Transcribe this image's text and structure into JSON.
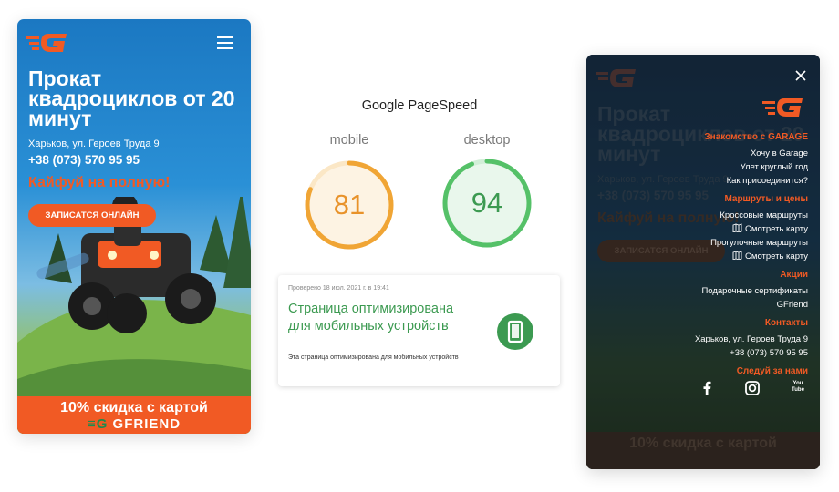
{
  "left_phone": {
    "headline": "Прокат квадроциклов от 20 минут",
    "address": "Харьков, ул. Героев Труда 9",
    "phone": "+38 (073) 570 95 95",
    "slogan": "Кайфуй на полную!",
    "cta_label": "ЗАПИСАТСЯ ОНЛАЙН",
    "discount": "10% скидка с картой",
    "partner_logo": "GFRIEND",
    "icons": [
      "garage-logo",
      "hamburger-menu-icon"
    ],
    "colors": {
      "accent": "#f15a24",
      "sky": "#1b78c2"
    }
  },
  "pagespeed": {
    "title": "Google PageSpeed",
    "gauges": [
      {
        "label": "mobile",
        "score": "81",
        "color": "#f0a535"
      },
      {
        "label": "desktop",
        "score": "94",
        "color": "#55c168"
      }
    ],
    "card": {
      "checked": "Проверено 18 июл. 2021 г. в 19:41",
      "heading": "Страница оптимизирована для мобильных устройств",
      "description": "Эта страница оптимизирована для мобильных устройств",
      "icon": "mobile-phone-icon"
    }
  },
  "menu_phone": {
    "bg": {
      "headline": "Прокат квадроциклов от 20 минут",
      "address": "Харьков, ул. Героев Труда 9",
      "phone": "+38 (073) 570 95 95",
      "slogan": "Кайфуй на полную!",
      "cta": "ЗАПИСАТСЯ ОНЛАЙН",
      "discount": "10% скидка с картой"
    },
    "sections": [
      {
        "title": "Знакомство с GARAGE",
        "items": [
          "Хочу в Garage",
          "Улет круглый год",
          "Как присоединится?"
        ]
      },
      {
        "title": "Маршруты и цены",
        "items": [
          "Кроссовые маршруты",
          "Смотреть карту",
          "Прогулочные маршруты",
          "Смотреть карту"
        ]
      },
      {
        "title": "Акции",
        "items": [
          "Подарочные сертификаты",
          "GFriend"
        ]
      },
      {
        "title": "Контакты",
        "items": [
          "Харьков, ул. Героев Труда 9",
          "+38 (073) 570 95 95"
        ]
      },
      {
        "title": "Следуй за нами",
        "items": []
      }
    ],
    "social_icons": [
      "facebook-icon",
      "instagram-icon",
      "youtube-icon"
    ],
    "youtube_label": "You Tube"
  }
}
